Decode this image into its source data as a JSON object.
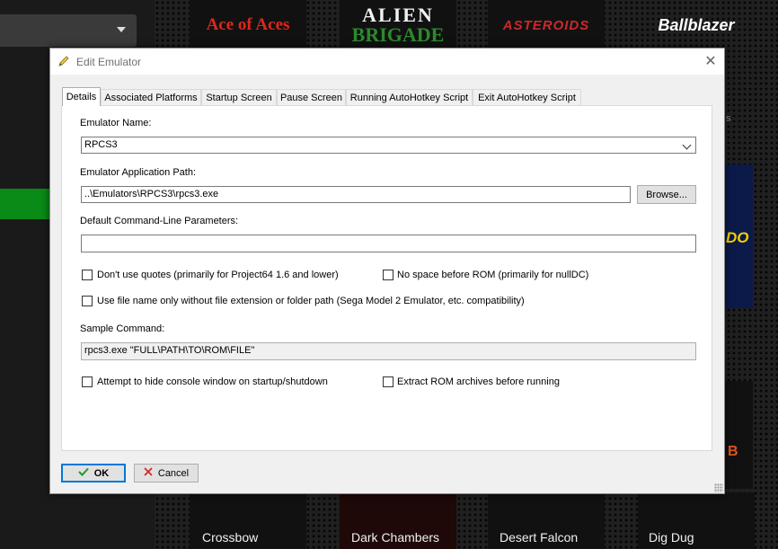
{
  "background": {
    "games_top": [
      "Ace of Aces",
      "ALIEN",
      "BRIGADE",
      "ASTEROIDS",
      "Ballblazer"
    ],
    "side_tile_text": "DO",
    "side_tile_text2": "B",
    "side_gray": "s",
    "games_bottom": [
      "Crossbow",
      "Dark Chambers",
      "Desert Falcon",
      "Dig Dug"
    ]
  },
  "dialog": {
    "title": "Edit Emulator",
    "title_icon": "pencil-icon",
    "close_glyph": "✕",
    "tabs": [
      "Details",
      "Associated Platforms",
      "Startup Screen",
      "Pause Screen",
      "Running AutoHotkey Script",
      "Exit AutoHotkey Script"
    ],
    "active_tab": "Details",
    "details": {
      "name_label": "Emulator Name:",
      "name_value": "RPCS3",
      "path_label": "Emulator Application Path:",
      "path_value": "..\\Emulators\\RPCS3\\rpcs3.exe",
      "browse_label": "Browse...",
      "params_label": "Default Command-Line Parameters:",
      "params_value": "",
      "chk_no_quotes": "Don't use quotes (primarily for Project64 1.6 and lower)",
      "chk_no_space": "No space before ROM (primarily for nullDC)",
      "chk_filename_only": "Use file name only without file extension or folder path (Sega Model 2 Emulator, etc. compatibility)",
      "sample_label": "Sample Command:",
      "sample_value": "rpcs3.exe \"FULL\\PATH\\TO\\ROM\\FILE\"",
      "chk_hide_console": "Attempt to hide console window on startup/shutdown",
      "chk_extract_rom": "Extract ROM archives before running"
    },
    "ok_label": "OK",
    "cancel_label": "Cancel",
    "colors": {
      "accent": "#0078d7",
      "ok_check": "#1a9a2a",
      "cancel_x": "#d42020"
    }
  }
}
